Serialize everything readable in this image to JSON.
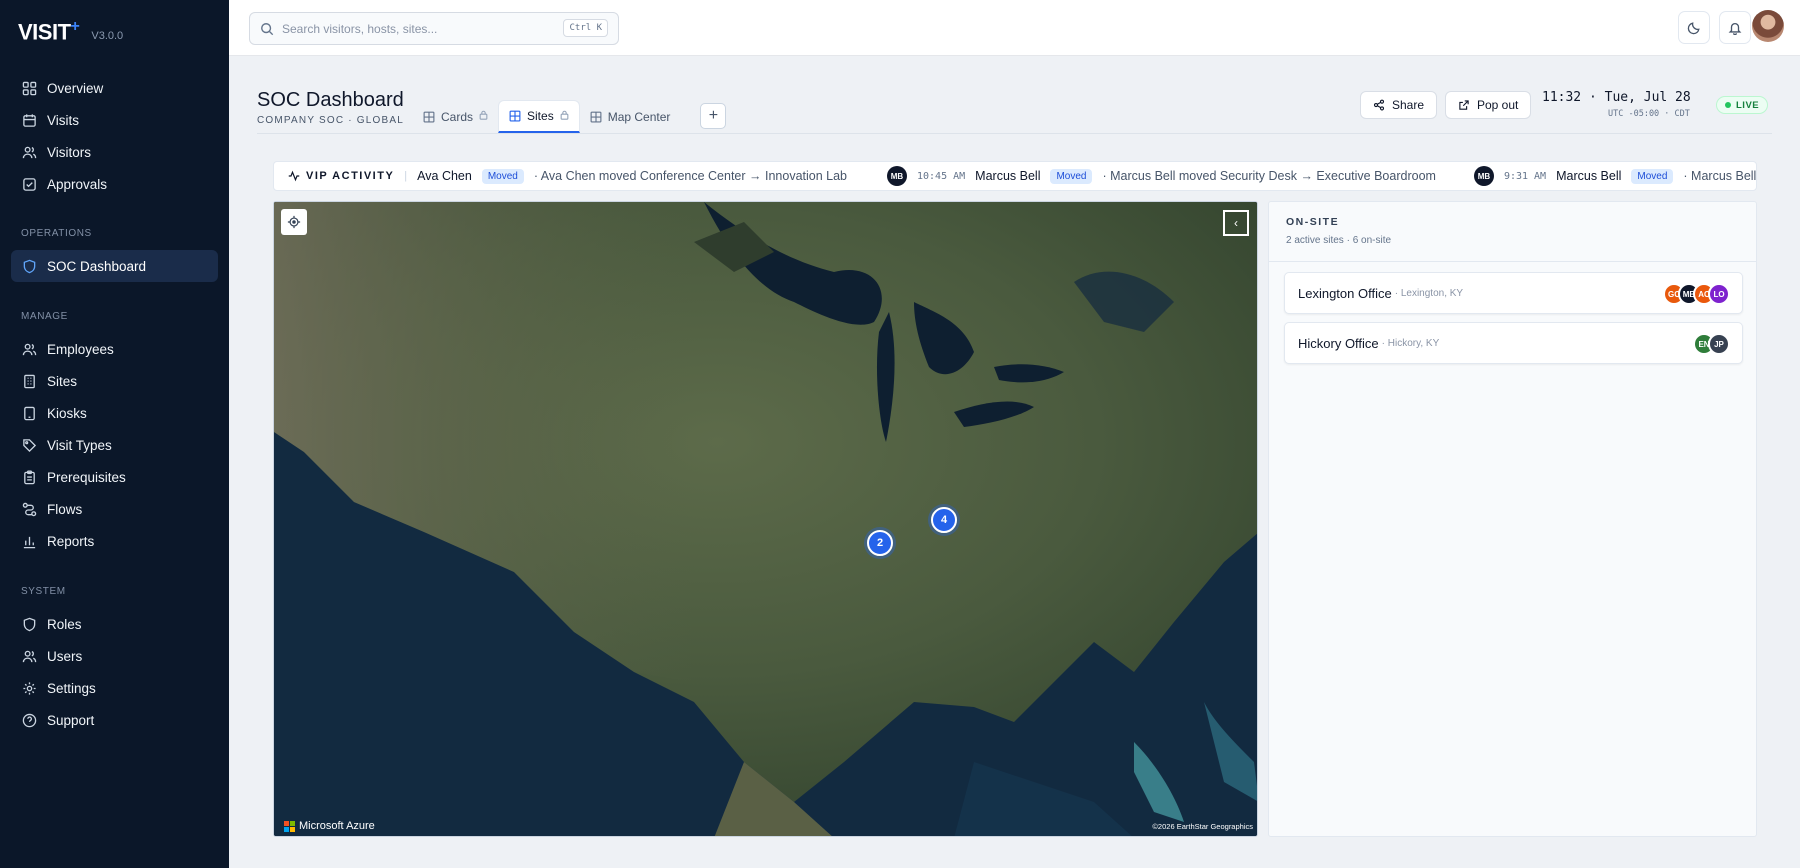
{
  "brand": {
    "name": "VISIT",
    "plus": "+",
    "version": "V3.0.0"
  },
  "sidebar": {
    "main": [
      {
        "label": "Overview",
        "icon": "grid-icon"
      },
      {
        "label": "Visits",
        "icon": "calendar-icon"
      },
      {
        "label": "Visitors",
        "icon": "users-icon"
      },
      {
        "label": "Approvals",
        "icon": "check-square-icon"
      }
    ],
    "sections": [
      {
        "title": "OPERATIONS",
        "items": [
          {
            "label": "SOC Dashboard",
            "icon": "shield-icon",
            "active": true
          }
        ]
      },
      {
        "title": "MANAGE",
        "items": [
          {
            "label": "Employees",
            "icon": "users-icon"
          },
          {
            "label": "Sites",
            "icon": "building-icon"
          },
          {
            "label": "Kiosks",
            "icon": "tablet-icon"
          },
          {
            "label": "Visit Types",
            "icon": "tag-icon"
          },
          {
            "label": "Prerequisites",
            "icon": "clipboard-icon"
          },
          {
            "label": "Flows",
            "icon": "route-icon"
          },
          {
            "label": "Reports",
            "icon": "bar-chart-icon"
          }
        ]
      },
      {
        "title": "SYSTEM",
        "items": [
          {
            "label": "Roles",
            "icon": "shield-icon"
          },
          {
            "label": "Users",
            "icon": "users-icon"
          },
          {
            "label": "Settings",
            "icon": "gear-icon"
          },
          {
            "label": "Support",
            "icon": "help-circle-icon"
          }
        ]
      }
    ]
  },
  "search": {
    "placeholder": "Search visitors, hosts, sites...",
    "shortcut": "Ctrl K"
  },
  "header": {
    "title": "SOC Dashboard",
    "subtitle": "COMPANY SOC · GLOBAL",
    "tabs": [
      {
        "label": "Cards",
        "locked": true
      },
      {
        "label": "Sites",
        "locked": true,
        "active": true
      },
      {
        "label": "Map Center",
        "locked": false
      }
    ],
    "add_tab": "+",
    "share_label": "Share",
    "popout_label": "Pop out",
    "clock": "11:32 · Tue, Jul 28",
    "timezone": "UTC -05:00 · CDT",
    "live_label": "LIVE"
  },
  "ticker": {
    "label": "VIP ACTIVITY",
    "first": {
      "name": "Ava Chen",
      "badge": "Moved",
      "text": "· Ava Chen moved Conference Center → Innovation Lab"
    },
    "second": {
      "initials": "MB",
      "time": "10:45 AM",
      "name": "Marcus Bell",
      "badge": "Moved",
      "text": "· Marcus Bell moved Security Desk → Executive Boardroom"
    },
    "third": {
      "initials": "MB",
      "time": "9:31 AM",
      "name": "Marcus Bell",
      "badge": "Moved",
      "text": "· Marcus Bell m"
    }
  },
  "map": {
    "clusters": [
      {
        "count": "2"
      },
      {
        "count": "4"
      }
    ],
    "attribution": "Microsoft Azure",
    "copyright": "©2026 EarthStar Geographics"
  },
  "onsite": {
    "title": "ON-SITE",
    "summary": "2 active sites · 6 on-site",
    "sites": [
      {
        "name": "Lexington Office",
        "location": "· Lexington, KY",
        "avatars": [
          {
            "i": "GC",
            "c": "#e8590c"
          },
          {
            "i": "MB",
            "c": "#0f172a"
          },
          {
            "i": "AC",
            "c": "#ea580c"
          },
          {
            "i": "LO",
            "c": "#7e22ce"
          }
        ]
      },
      {
        "name": "Hickory Office",
        "location": "· Hickory, KY",
        "avatars": [
          {
            "i": "EN",
            "c": "#2f7d3a"
          },
          {
            "i": "JP",
            "c": "#374151"
          }
        ]
      }
    ]
  },
  "colors": {
    "accent": "#2563eb",
    "sidebar_bg": "#0b1729",
    "live": "#22c55e"
  }
}
